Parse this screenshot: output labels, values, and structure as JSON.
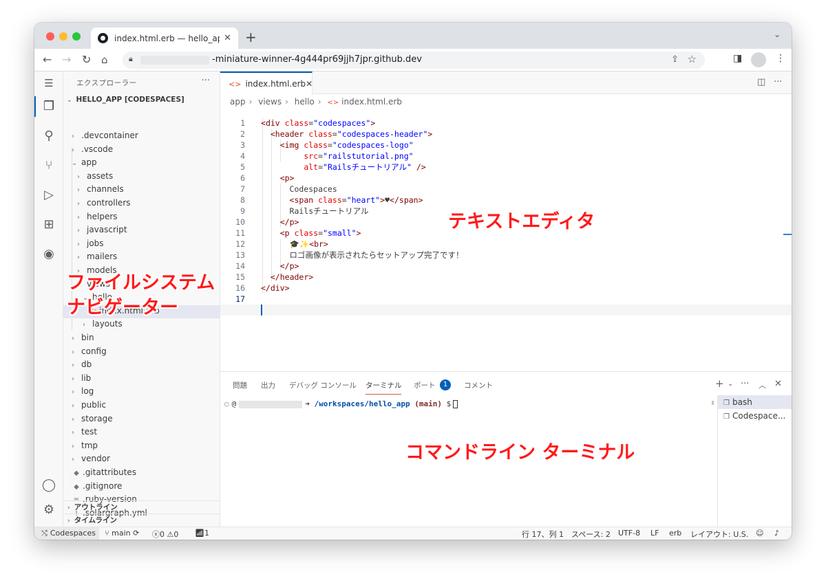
{
  "browser": {
    "tab_title": "index.html.erb — hello_app [Co",
    "address": "-miniature-winner-4g444pr69jjh7jpr.github.dev"
  },
  "sidebar": {
    "title": "エクスプローラー",
    "more": "···",
    "root": "HELLO_APP [CODESPACES]",
    "items": [
      {
        "label": ".devcontainer",
        "type": "folder",
        "open": false,
        "depth": 1
      },
      {
        "label": ".vscode",
        "type": "folder",
        "open": false,
        "depth": 1
      },
      {
        "label": "app",
        "type": "folder",
        "open": true,
        "depth": 1
      },
      {
        "label": "assets",
        "type": "folder",
        "open": false,
        "depth": 2
      },
      {
        "label": "channels",
        "type": "folder",
        "open": false,
        "depth": 2
      },
      {
        "label": "controllers",
        "type": "folder",
        "open": false,
        "depth": 2
      },
      {
        "label": "helpers",
        "type": "folder",
        "open": false,
        "depth": 2
      },
      {
        "label": "javascript",
        "type": "folder",
        "open": false,
        "depth": 2
      },
      {
        "label": "jobs",
        "type": "folder",
        "open": false,
        "depth": 2
      },
      {
        "label": "mailers",
        "type": "folder",
        "open": false,
        "depth": 2
      },
      {
        "label": "models",
        "type": "folder",
        "open": false,
        "depth": 2
      },
      {
        "label": "views",
        "type": "folder",
        "open": true,
        "depth": 2
      },
      {
        "label": "hello",
        "type": "folder",
        "open": true,
        "depth": 3
      },
      {
        "label": "index.html.erb",
        "type": "erb",
        "open": false,
        "depth": 4
      },
      {
        "label": "layouts",
        "type": "folder",
        "open": false,
        "depth": 3
      },
      {
        "label": "bin",
        "type": "folder",
        "open": false,
        "depth": 1
      },
      {
        "label": "config",
        "type": "folder",
        "open": false,
        "depth": 1
      },
      {
        "label": "db",
        "type": "folder",
        "open": false,
        "depth": 1
      },
      {
        "label": "lib",
        "type": "folder",
        "open": false,
        "depth": 1
      },
      {
        "label": "log",
        "type": "folder",
        "open": false,
        "depth": 1
      },
      {
        "label": "public",
        "type": "folder",
        "open": false,
        "depth": 1
      },
      {
        "label": "storage",
        "type": "folder",
        "open": false,
        "depth": 1
      },
      {
        "label": "test",
        "type": "folder",
        "open": false,
        "depth": 1
      },
      {
        "label": "tmp",
        "type": "folder",
        "open": false,
        "depth": 1
      },
      {
        "label": "vendor",
        "type": "folder",
        "open": false,
        "depth": 1
      },
      {
        "label": ".gitattributes",
        "type": "git",
        "open": false,
        "depth": 1
      },
      {
        "label": ".gitignore",
        "type": "git",
        "open": false,
        "depth": 1
      },
      {
        "label": ".ruby-version",
        "type": "text",
        "open": false,
        "depth": 1
      },
      {
        "label": ".solargraph.yml",
        "type": "yml",
        "open": false,
        "depth": 1
      }
    ],
    "outline": "アウトライン",
    "timeline": "タイムライン"
  },
  "editor": {
    "tab_label": "index.html.erb",
    "breadcrumb": [
      "app",
      "views",
      "hello",
      "index.html.erb"
    ],
    "lines": [
      "<div class=\"codespaces\">",
      "  <header class=\"codespaces-header\">",
      "    <img class=\"codespaces-logo\"",
      "         src=\"railstutorial.png\"",
      "         alt=\"Railsチュートリアル\" />",
      "    <p>",
      "      Codespaces",
      "      <span class=\"heart\">♥</span>",
      "      Railsチュートリアル",
      "    </p>",
      "    <p class=\"small\">",
      "      🎓✨<br>",
      "      ロゴ画像が表示されたらセットアップ完了です！",
      "    </p>",
      "  </header>",
      "</div>",
      ""
    ]
  },
  "panel": {
    "tabs": [
      "問題",
      "出力",
      "デバッグ コンソール",
      "ターミナル",
      "ポート",
      "コメント"
    ],
    "ports_badge": "1",
    "terminal": {
      "user_prefix": "@",
      "arrow": "➜",
      "path": "/workspaces/hello_app",
      "branch_open": "(",
      "branch": "main",
      "branch_close": ")",
      "prompt": "$"
    },
    "terminals": [
      "bash",
      "Codespace..."
    ]
  },
  "statusbar": {
    "remote": "Codespaces",
    "branch": "main",
    "errors": "0",
    "warnings": "0",
    "ports": "1",
    "position": "行 17、列 1",
    "spaces": "スペース: 2",
    "encoding": "UTF-8",
    "eol": "LF",
    "language": "erb",
    "layout": "レイアウト: U.S."
  },
  "annotations": {
    "editor": "テキストエディタ",
    "navigator_line1": "ファイルシステム",
    "navigator_line2": "ナビゲーター",
    "terminal": "コマンドライン ターミナル"
  },
  "colors": {
    "accent": "#005fb8",
    "annotation": "#ff1a1a",
    "tag": "#800000",
    "attribute": "#e50000",
    "string": "#0000ff"
  }
}
